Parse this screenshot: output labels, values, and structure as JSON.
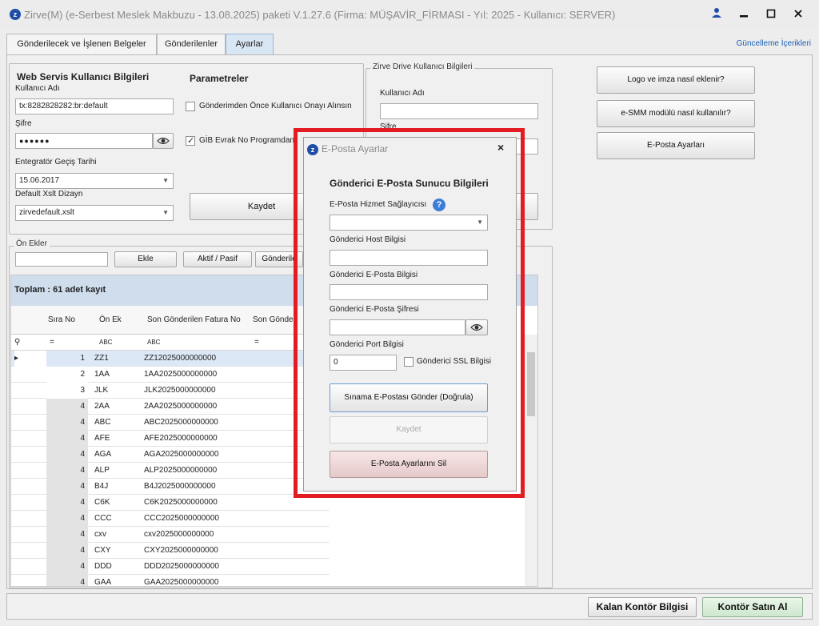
{
  "window": {
    "title": "Zirve(M)  (e-Serbest Meslek Makbuzu - 13.08.2025) paketi V.1.27.6 (Firma: MÜŞAVİR_FİRMASI - Yıl: 2025 - Kullanıcı: SERVER)"
  },
  "tabs": [
    "Gönderilecek ve İşlenen Belgeler",
    "Gönderilenler",
    "Ayarlar"
  ],
  "update_link": "Güncelleme İçerikleri",
  "web_service": {
    "title": "Web Servis Kullanıcı Bilgileri",
    "username_label": "Kullanıcı Adı",
    "username_value": "tx:8282828282:br:default",
    "password_label": "Şifre",
    "password_value": "●●●●●●",
    "date_label": "Entegratör Geçiş Tarihi",
    "date_value": "15.06.2017",
    "xslt_label": "Default Xslt Dizayn",
    "xslt_value": "zirvedefault.xslt"
  },
  "params": {
    "title": "Parametreler",
    "approval_label": "Gönderimden Önce Kullanıcı Onayı Alınsın",
    "gib_label": "GİB Evrak No Programdan",
    "save_label": "Kaydet"
  },
  "drive": {
    "title": "Zirve Drive Kullanıcı Bilgileri",
    "username_label": "Kullanıcı Adı",
    "password_label": "Şifre"
  },
  "help": {
    "logo_label": "Logo ve imza nasıl eklenir?",
    "esmm_label": "e-SMM modülü nasıl kullanılır?",
    "email_label": "E-Posta Ayarları"
  },
  "prefixes": {
    "title": "Ön Ekler",
    "add_label": "Ekle",
    "toggle_label": "Aktif / Pasif",
    "sent_label": "Gönderile",
    "total_label": "Toplam : 61 adet kayıt",
    "columns": [
      "Sıra No",
      "Ön Ek",
      "Son Gönderilen Fatura No",
      "Son Gönder"
    ],
    "rows": [
      [
        "1",
        "ZZ1",
        "ZZ12025000000000"
      ],
      [
        "2",
        "1AA",
        "1AA2025000000000"
      ],
      [
        "3",
        "JLK",
        "JLK2025000000000"
      ],
      [
        "4",
        "2AA",
        "2AA2025000000000"
      ],
      [
        "4",
        "ABC",
        "ABC2025000000000"
      ],
      [
        "4",
        "AFE",
        "AFE2025000000000"
      ],
      [
        "4",
        "AGA",
        "AGA2025000000000"
      ],
      [
        "4",
        "ALP",
        "ALP2025000000000"
      ],
      [
        "4",
        "B4J",
        "B4J2025000000000"
      ],
      [
        "4",
        "C6K",
        "C6K2025000000000"
      ],
      [
        "4",
        "CCC",
        "CCC2025000000000"
      ],
      [
        "4",
        "cxv",
        "cxv2025000000000"
      ],
      [
        "4",
        "CXY",
        "CXY2025000000000"
      ],
      [
        "4",
        "DDD",
        "DDD2025000000000"
      ],
      [
        "4",
        "GAA",
        "GAA2025000000000"
      ]
    ]
  },
  "dialog": {
    "title": "E-Posta Ayarlar",
    "heading": "Gönderici E-Posta Sunucu Bilgileri",
    "provider_label": "E-Posta Hizmet Sağlayıcısı",
    "host_label": "Gönderici Host Bilgisi",
    "email_label": "Gönderici E-Posta Bilgisi",
    "password_label": "Gönderici E-Posta Şifresi",
    "port_label": "Gönderici Port Bilgisi",
    "port_value": "0",
    "ssl_label": "Gönderici SSL Bilgisi",
    "test_label": "Sınama E-Postası Gönder (Doğrula)",
    "save_label": "Kaydet",
    "delete_label": "E-Posta Ayarlarını Sil"
  },
  "bottom": {
    "balance_label": "Kalan Kontör Bilgisi",
    "buy_label": "Kontör Satın Al"
  },
  "colors": {
    "highlight": "#e31b23",
    "accent": "#1f4ea8",
    "selected_row": "#dce8f6"
  }
}
